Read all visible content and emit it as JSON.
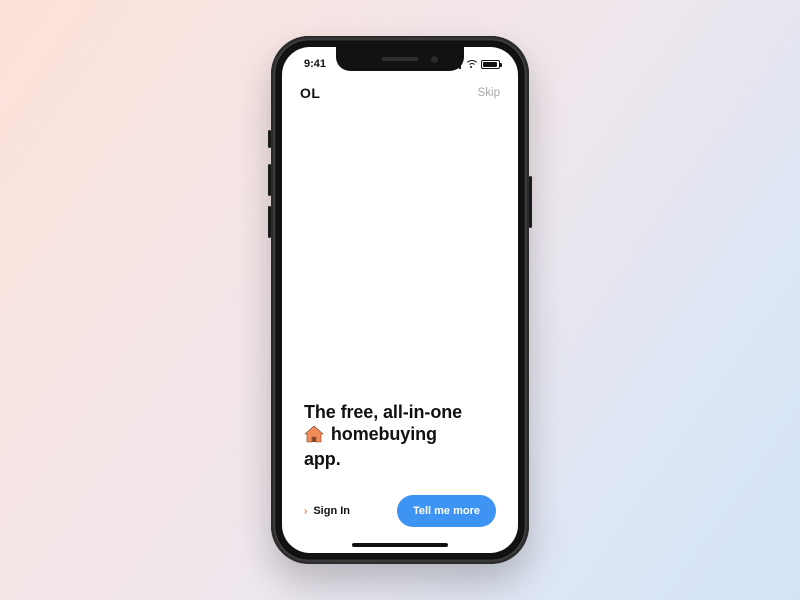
{
  "status": {
    "time": "9:41"
  },
  "header": {
    "logo": "OL",
    "skip": "Skip"
  },
  "hero": {
    "line1": "The free, all-in-one",
    "line2_after_icon": "homebuying",
    "line3": "app."
  },
  "actions": {
    "signin_label": "Sign In",
    "cta_label": "Tell me more"
  },
  "colors": {
    "accent_blue": "#3e94f2",
    "accent_orange": "#ff6a3d"
  }
}
